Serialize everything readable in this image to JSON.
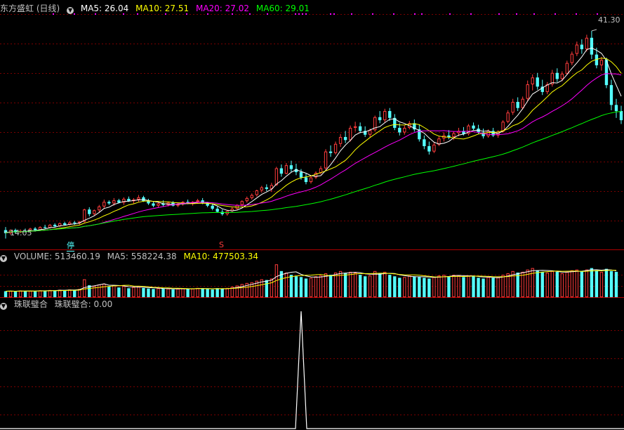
{
  "main_panel": {
    "title": "东方盛虹 (日线)",
    "ma_labels": [
      "MA5: 26.04",
      "MA10: 27.51",
      "MA20: 27.02",
      "MA60: 29.01"
    ],
    "ma_colors": [
      "#ffffff",
      "#ffff00",
      "#ff00ff",
      "#00ff00"
    ],
    "high_label": "41.30",
    "low_label": "14.05",
    "marker_ting": "停",
    "marker_s": "S"
  },
  "volume_panel": {
    "labels": [
      "VOLUME: 513460.19",
      "MA5: 558224.38",
      "MA10: 477503.34"
    ],
    "label_colors": [
      "#c0c0c0",
      "#c0c0c0",
      "#ffff00"
    ]
  },
  "indicator_panel": {
    "labels": [
      "珠联璧合",
      "珠联璧合: 0.00"
    ],
    "label_colors": [
      "#c0c0c0",
      "#c0c0c0"
    ]
  },
  "colors": {
    "up": "#ff3c3c",
    "down": "#54ffff",
    "grid": "#7a0000",
    "separator": "#b00000",
    "ma5": "#ffffff",
    "ma10": "#ffff00",
    "ma20": "#ff00ff",
    "ma60": "#00ff00",
    "dots": "#ff00ff",
    "spike": "#ffffff"
  },
  "chart_data": {
    "type": "candlestick",
    "series_name": "东方盛虹",
    "ylim": [
      14.05,
      41.3
    ],
    "candles": [
      [
        15.2,
        15.6,
        14.1,
        14.8
      ],
      [
        14.8,
        15.3,
        14.6,
        15.2
      ],
      [
        15.2,
        15.4,
        14.8,
        14.9
      ],
      [
        14.9,
        15.3,
        14.8,
        15.1
      ],
      [
        15.1,
        15.4,
        14.9,
        15.0
      ],
      [
        15.0,
        15.5,
        14.9,
        15.4
      ],
      [
        15.4,
        15.6,
        15.0,
        15.2
      ],
      [
        15.2,
        15.7,
        15.1,
        15.6
      ],
      [
        15.6,
        15.9,
        15.3,
        15.5
      ],
      [
        15.5,
        16.0,
        15.4,
        15.9
      ],
      [
        15.9,
        16.1,
        15.6,
        15.7
      ],
      [
        15.7,
        16.2,
        15.6,
        16.1
      ],
      [
        16.1,
        16.3,
        15.8,
        15.9
      ],
      [
        15.9,
        16.4,
        15.8,
        16.2
      ],
      [
        16.2,
        16.4,
        15.9,
        16.1
      ],
      [
        16.1,
        16.4,
        15.9,
        16.3
      ],
      [
        16.3,
        18.0,
        16.2,
        17.9
      ],
      [
        17.9,
        18.2,
        17.0,
        17.3
      ],
      [
        17.3,
        17.9,
        17.1,
        17.8
      ],
      [
        17.8,
        18.5,
        17.5,
        18.3
      ],
      [
        18.3,
        19.2,
        18.0,
        18.9
      ],
      [
        18.9,
        19.1,
        18.5,
        18.7
      ],
      [
        18.7,
        19.4,
        18.4,
        19.1
      ],
      [
        19.1,
        19.3,
        18.7,
        18.8
      ],
      [
        18.8,
        19.5,
        18.5,
        19.3
      ],
      [
        19.3,
        19.6,
        18.9,
        19.0
      ],
      [
        19.0,
        19.4,
        18.7,
        19.2
      ],
      [
        19.2,
        19.8,
        18.9,
        19.5
      ],
      [
        19.5,
        19.7,
        18.9,
        19.0
      ],
      [
        19.0,
        19.3,
        18.5,
        18.7
      ],
      [
        18.7,
        19.0,
        18.2,
        18.4
      ],
      [
        18.4,
        18.9,
        18.2,
        18.7
      ],
      [
        18.7,
        19.1,
        18.3,
        18.5
      ],
      [
        18.5,
        18.9,
        18.3,
        18.8
      ],
      [
        18.8,
        19.0,
        18.3,
        18.4
      ],
      [
        18.4,
        18.8,
        18.2,
        18.6
      ],
      [
        18.6,
        19.0,
        18.4,
        18.9
      ],
      [
        18.9,
        19.2,
        18.6,
        18.7
      ],
      [
        18.7,
        19.0,
        18.4,
        18.9
      ],
      [
        18.9,
        19.3,
        18.7,
        19.1
      ],
      [
        19.1,
        19.4,
        18.6,
        18.7
      ],
      [
        18.7,
        18.9,
        18.2,
        18.4
      ],
      [
        18.4,
        18.6,
        17.8,
        18.0
      ],
      [
        18.0,
        18.3,
        17.5,
        17.6
      ],
      [
        17.6,
        17.9,
        17.1,
        17.3
      ],
      [
        17.3,
        17.8,
        17.1,
        17.7
      ],
      [
        17.7,
        18.2,
        17.5,
        18.0
      ],
      [
        18.0,
        18.6,
        17.9,
        18.5
      ],
      [
        18.5,
        19.1,
        18.3,
        19.0
      ],
      [
        19.0,
        19.6,
        18.8,
        19.4
      ],
      [
        19.4,
        20.0,
        19.2,
        19.8
      ],
      [
        19.8,
        20.5,
        19.6,
        20.4
      ],
      [
        20.4,
        21.0,
        20.1,
        20.8
      ],
      [
        20.8,
        21.2,
        20.3,
        20.6
      ],
      [
        20.6,
        21.4,
        20.2,
        21.1
      ],
      [
        21.1,
        23.5,
        21.0,
        23.3
      ],
      [
        23.3,
        23.8,
        22.2,
        22.6
      ],
      [
        22.6,
        24.0,
        22.5,
        23.7
      ],
      [
        23.7,
        24.3,
        22.8,
        23.2
      ],
      [
        23.2,
        23.9,
        22.4,
        22.8
      ],
      [
        22.8,
        23.2,
        21.8,
        22.1
      ],
      [
        22.1,
        22.6,
        21.2,
        21.5
      ],
      [
        21.5,
        22.3,
        21.3,
        22.1
      ],
      [
        22.1,
        22.9,
        21.9,
        22.7
      ],
      [
        22.7,
        23.6,
        22.5,
        23.3
      ],
      [
        23.3,
        25.8,
        23.1,
        25.5
      ],
      [
        25.5,
        26.3,
        24.8,
        25.3
      ],
      [
        25.3,
        26.8,
        25.1,
        26.5
      ],
      [
        26.5,
        27.8,
        26.1,
        27.4
      ],
      [
        27.4,
        28.2,
        26.6,
        27.0
      ],
      [
        27.0,
        28.9,
        26.8,
        28.6
      ],
      [
        28.6,
        29.4,
        28.1,
        28.8
      ],
      [
        28.8,
        29.3,
        27.9,
        28.2
      ],
      [
        28.2,
        28.8,
        27.4,
        27.7
      ],
      [
        27.7,
        28.5,
        27.3,
        28.3
      ],
      [
        28.3,
        30.2,
        28.1,
        30.0
      ],
      [
        30.0,
        30.8,
        29.2,
        29.6
      ],
      [
        29.6,
        31.1,
        29.3,
        30.8
      ],
      [
        30.8,
        31.2,
        29.5,
        29.9
      ],
      [
        29.9,
        30.4,
        28.3,
        28.6
      ],
      [
        28.6,
        29.2,
        27.6,
        28.0
      ],
      [
        28.0,
        28.9,
        27.7,
        28.6
      ],
      [
        28.6,
        29.5,
        28.4,
        29.2
      ],
      [
        29.2,
        29.7,
        28.1,
        28.4
      ],
      [
        28.4,
        29.0,
        26.8,
        27.1
      ],
      [
        27.1,
        27.6,
        25.8,
        26.2
      ],
      [
        26.2,
        26.8,
        25.1,
        25.5
      ],
      [
        25.5,
        26.7,
        25.3,
        26.4
      ],
      [
        26.4,
        27.5,
        26.2,
        27.2
      ],
      [
        27.2,
        28.0,
        26.8,
        27.6
      ],
      [
        27.6,
        28.3,
        27.1,
        27.4
      ],
      [
        27.4,
        28.1,
        27.0,
        27.9
      ],
      [
        27.9,
        28.6,
        27.5,
        28.2
      ],
      [
        28.2,
        28.7,
        27.6,
        27.8
      ],
      [
        27.8,
        29.1,
        27.6,
        28.9
      ],
      [
        28.9,
        29.3,
        28.3,
        28.5
      ],
      [
        28.5,
        29.0,
        27.8,
        28.0
      ],
      [
        28.0,
        28.5,
        27.2,
        27.5
      ],
      [
        27.5,
        28.4,
        27.3,
        28.2
      ],
      [
        28.2,
        28.6,
        27.4,
        27.6
      ],
      [
        27.6,
        28.3,
        27.3,
        28.1
      ],
      [
        28.1,
        29.6,
        28.0,
        29.4
      ],
      [
        29.4,
        30.9,
        29.2,
        30.6
      ],
      [
        30.6,
        32.4,
        30.3,
        32.0
      ],
      [
        32.0,
        32.6,
        30.8,
        31.2
      ],
      [
        31.2,
        32.7,
        31.0,
        32.4
      ],
      [
        32.4,
        34.8,
        32.1,
        34.3
      ],
      [
        34.3,
        35.6,
        33.5,
        35.2
      ],
      [
        35.2,
        35.8,
        33.6,
        34.0
      ],
      [
        34.0,
        34.9,
        32.9,
        33.3
      ],
      [
        33.3,
        34.6,
        33.0,
        34.3
      ],
      [
        34.3,
        36.2,
        34.0,
        35.8
      ],
      [
        35.8,
        36.4,
        34.6,
        35.0
      ],
      [
        35.0,
        36.0,
        34.7,
        35.7
      ],
      [
        35.7,
        37.4,
        35.5,
        37.1
      ],
      [
        37.1,
        38.6,
        36.8,
        38.3
      ],
      [
        38.3,
        39.9,
        38.0,
        39.5
      ],
      [
        39.5,
        40.2,
        38.3,
        38.9
      ],
      [
        38.9,
        40.8,
        38.6,
        40.4
      ],
      [
        40.4,
        41.3,
        37.6,
        38.2
      ],
      [
        38.2,
        39.1,
        36.4,
        36.8
      ],
      [
        36.8,
        37.9,
        36.1,
        37.5
      ],
      [
        37.5,
        37.8,
        33.8,
        34.2
      ],
      [
        34.2,
        34.9,
        30.9,
        31.6
      ],
      [
        31.6,
        32.4,
        29.9,
        30.8
      ],
      [
        30.8,
        31.5,
        29.1,
        29.6
      ]
    ],
    "volume": [
      40,
      42,
      38,
      45,
      41,
      44,
      39,
      46,
      43,
      48,
      45,
      50,
      47,
      52,
      49,
      55,
      120,
      80,
      75,
      85,
      90,
      70,
      80,
      65,
      75,
      60,
      68,
      72,
      62,
      58,
      55,
      60,
      56,
      58,
      52,
      57,
      60,
      54,
      58,
      62,
      58,
      55,
      52,
      60,
      56,
      62,
      70,
      78,
      88,
      95,
      100,
      110,
      120,
      115,
      125,
      220,
      175,
      165,
      150,
      140,
      135,
      125,
      130,
      140,
      145,
      160,
      150,
      165,
      175,
      160,
      170,
      165,
      150,
      140,
      145,
      175,
      160,
      170,
      150,
      140,
      130,
      135,
      145,
      140,
      135,
      130,
      125,
      135,
      145,
      150,
      140,
      150,
      145,
      135,
      145,
      140,
      130,
      125,
      135,
      130,
      135,
      150,
      160,
      175,
      165,
      170,
      185,
      195,
      180,
      170,
      165,
      175,
      170,
      160,
      170,
      180,
      185,
      175,
      185,
      195,
      180,
      170,
      190,
      175,
      170
    ],
    "volume_ylim": [
      0,
      240
    ],
    "indicator": {
      "peak_index": 60,
      "peak_value": 1
    }
  }
}
